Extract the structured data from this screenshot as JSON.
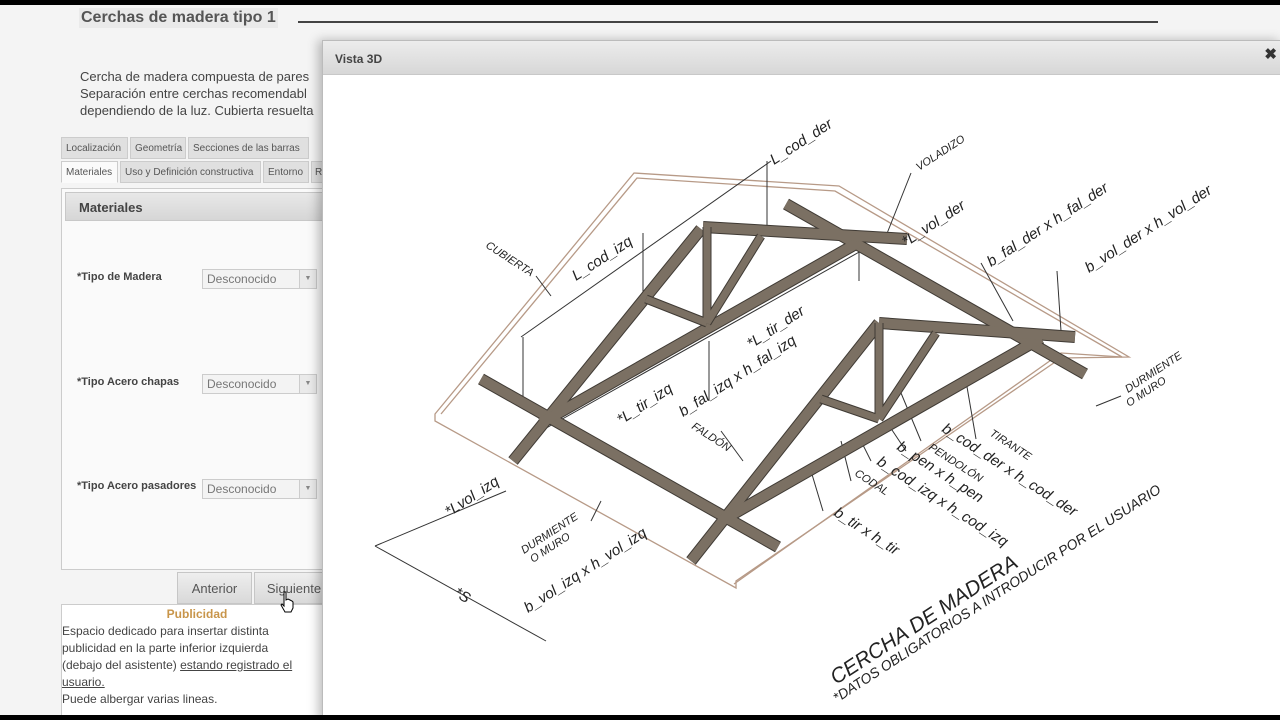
{
  "page": {
    "title": "Cerchas de madera tipo 1",
    "intro_lines": [
      "Cercha de madera compuesta de pares",
      "Separación entre cerchas recomendabl",
      "dependiendo de la luz. Cubierta resuelta"
    ]
  },
  "tabs": {
    "row1": [
      "Localización",
      "Geometría",
      "Secciones de las barras"
    ],
    "row2": [
      "Materiales",
      "Uso y Definición constructiva",
      "Entorno",
      "R"
    ]
  },
  "panel": {
    "header": "Materiales",
    "fields": [
      {
        "label": "*Tipo de Madera",
        "value": "Desconocido"
      },
      {
        "label": "*Tipo Acero chapas",
        "value": "Desconocido"
      },
      {
        "label": "*Tipo Acero pasadores",
        "value": "Desconocido"
      }
    ]
  },
  "buttons": {
    "prev": "Anterior",
    "next": "Siguiente"
  },
  "ad": {
    "title": "Publicidad",
    "line1": "Espacio dedicado para insertar distinta",
    "line2": "publicidad en la parte inferior izquierda",
    "line3a": "(debajo del asistente) ",
    "line3b": "estando registrado el",
    "line4": "usuario.",
    "line5": "Puede albergar varias lineas."
  },
  "dialog": {
    "title": "Vista 3D",
    "close_icon": "close-icon"
  },
  "drawing": {
    "labels": {
      "l_cod_der": "L_cod_der",
      "voladizo": "VOLADIZO",
      "l_vol_der": "*L_vol_der",
      "b_fal_der": "b_fal_der x h_fal_der",
      "b_vol_der": "b_vol_der x h_vol_der",
      "cubierta": "CUBIERTA",
      "l_cod_izq": "L_cod_izq",
      "l_tir_der": "*L_tir_der",
      "b_fal_izq": "b_fal_izq x h_fal_izq",
      "l_tir_izq": "*L_tir_izq",
      "durmiente_der_1": "DURMIENTE",
      "durmiente_der_2": "O MURO",
      "faldon": "FALDÓN",
      "tirante": "TIRANTE",
      "b_cod_der": "b_cod_der x h_cod_der",
      "pendolon": "PENDOLÓN",
      "b_pen": "b_pen x h_pen",
      "codal": "CODAL",
      "b_cod_izq": "b_cod_izq x h_cod_izq",
      "l_vol_izq": "*Lvol_izq",
      "durmiente_izq_1": "DURMIENTE",
      "durmiente_izq_2": "O MURO",
      "b_tir": "b_tir x h_tir",
      "b_vol_izq": "b_vol_izq x h_vol_izq",
      "s": "*S",
      "caption_1": "CERCHA DE MADERA",
      "caption_2": "*DATOS OBLIGATORIOS A INTRODUCIR POR EL USUARIO"
    }
  }
}
